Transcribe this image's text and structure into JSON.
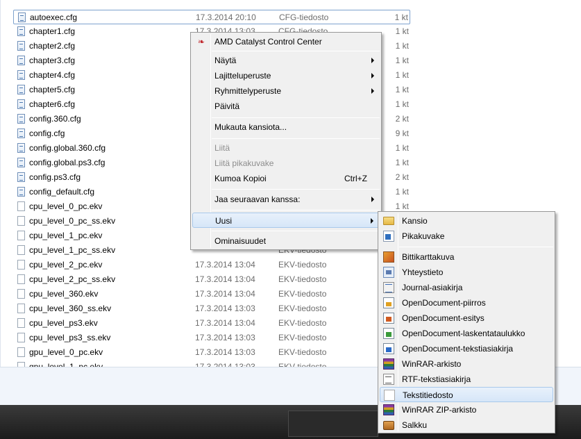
{
  "files": [
    {
      "name": "autoexec.cfg",
      "date": "17.3.2014 20:10",
      "type": "CFG-tiedosto",
      "size": "1 kt",
      "icon": "cfg-file-icon",
      "selected": true
    },
    {
      "name": "chapter1.cfg",
      "date": "17.3.2014 13:03",
      "type": "CFG-tiedosto",
      "size": "1 kt",
      "icon": "cfg-file-icon"
    },
    {
      "name": "chapter2.cfg",
      "date": "",
      "type": "",
      "size": "1 kt",
      "icon": "cfg-file-icon"
    },
    {
      "name": "chapter3.cfg",
      "date": "",
      "type": "",
      "size": "1 kt",
      "icon": "cfg-file-icon"
    },
    {
      "name": "chapter4.cfg",
      "date": "",
      "type": "",
      "size": "1 kt",
      "icon": "cfg-file-icon"
    },
    {
      "name": "chapter5.cfg",
      "date": "",
      "type": "",
      "size": "1 kt",
      "icon": "cfg-file-icon"
    },
    {
      "name": "chapter6.cfg",
      "date": "",
      "type": "",
      "size": "1 kt",
      "icon": "cfg-file-icon"
    },
    {
      "name": "config.360.cfg",
      "date": "",
      "type": "",
      "size": "2 kt",
      "icon": "cfg-file-icon"
    },
    {
      "name": "config.cfg",
      "date": "",
      "type": "",
      "size": "9 kt",
      "icon": "cfg-file-icon"
    },
    {
      "name": "config.global.360.cfg",
      "date": "",
      "type": "",
      "size": "1 kt",
      "icon": "cfg-file-icon"
    },
    {
      "name": "config.global.ps3.cfg",
      "date": "",
      "type": "",
      "size": "1 kt",
      "icon": "cfg-file-icon"
    },
    {
      "name": "config.ps3.cfg",
      "date": "",
      "type": "",
      "size": "2 kt",
      "icon": "cfg-file-icon"
    },
    {
      "name": "config_default.cfg",
      "date": "",
      "type": "",
      "size": "1 kt",
      "icon": "cfg-file-icon"
    },
    {
      "name": "cpu_level_0_pc.ekv",
      "date": "",
      "type": "",
      "size": "1 kt",
      "icon": "file-icon"
    },
    {
      "name": "cpu_level_0_pc_ss.ekv",
      "date": "",
      "type": "",
      "size": "",
      "icon": "file-icon"
    },
    {
      "name": "cpu_level_1_pc.ekv",
      "date": "",
      "type": "",
      "size": "",
      "icon": "file-icon"
    },
    {
      "name": "cpu_level_1_pc_ss.ekv",
      "date": "",
      "type": "EKV-tiedosto",
      "size": "",
      "icon": "file-icon"
    },
    {
      "name": "cpu_level_2_pc.ekv",
      "date": "17.3.2014 13:04",
      "type": "EKV-tiedosto",
      "size": "",
      "icon": "file-icon"
    },
    {
      "name": "cpu_level_2_pc_ss.ekv",
      "date": "17.3.2014 13:04",
      "type": "EKV-tiedosto",
      "size": "",
      "icon": "file-icon"
    },
    {
      "name": "cpu_level_360.ekv",
      "date": "17.3.2014 13:04",
      "type": "EKV-tiedosto",
      "size": "",
      "icon": "file-icon"
    },
    {
      "name": "cpu_level_360_ss.ekv",
      "date": "17.3.2014 13:03",
      "type": "EKV-tiedosto",
      "size": "",
      "icon": "file-icon"
    },
    {
      "name": "cpu_level_ps3.ekv",
      "date": "17.3.2014 13:04",
      "type": "EKV-tiedosto",
      "size": "",
      "icon": "file-icon"
    },
    {
      "name": "cpu_level_ps3_ss.ekv",
      "date": "17.3.2014 13:03",
      "type": "EKV-tiedosto",
      "size": "",
      "icon": "file-icon"
    },
    {
      "name": "gpu_level_0_pc.ekv",
      "date": "17.3.2014 13:03",
      "type": "EKV-tiedosto",
      "size": "",
      "icon": "file-icon"
    },
    {
      "name": "gpu_level_1_pc.ekv",
      "date": "17.3.2014 13:03",
      "type": "EKV-tiedosto",
      "size": "",
      "icon": "file-icon"
    }
  ],
  "context_menu": {
    "amd": "AMD Catalyst Control Center",
    "view": "Näytä",
    "sort": "Lajitteluperuste",
    "group": "Ryhmittelyperuste",
    "refresh": "Päivitä",
    "customize": "Mukauta kansiota...",
    "paste": "Liitä",
    "paste_shortcut": "Liitä pikakuvake",
    "undo": "Kumoa Kopioi",
    "undo_shortcut": "Ctrl+Z",
    "share": "Jaa seuraavan kanssa:",
    "new": "Uusi",
    "properties": "Ominaisuudet"
  },
  "new_submenu": [
    {
      "label": "Kansio",
      "icon": "folder-icon"
    },
    {
      "label": "Pikakuvake",
      "icon": "shortcut-icon"
    },
    {
      "label": "Bittikarttakuva",
      "icon": "bitmap-icon"
    },
    {
      "label": "Yhteystieto",
      "icon": "contact-icon"
    },
    {
      "label": "Journal-asiakirja",
      "icon": "journal-icon"
    },
    {
      "label": "OpenDocument-piirros",
      "icon": "odg-icon"
    },
    {
      "label": "OpenDocument-esitys",
      "icon": "odp-icon"
    },
    {
      "label": "OpenDocument-laskentataulukko",
      "icon": "ods-icon"
    },
    {
      "label": "OpenDocument-tekstiasiakirja",
      "icon": "odt-icon"
    },
    {
      "label": "WinRAR-arkisto",
      "icon": "winrar-icon"
    },
    {
      "label": "RTF-tekstiasiakirja",
      "icon": "rtf-icon"
    },
    {
      "label": "Tekstitiedosto",
      "icon": "text-file-icon"
    },
    {
      "label": "WinRAR ZIP-arkisto",
      "icon": "winrar-zip-icon"
    },
    {
      "label": "Salkku",
      "icon": "briefcase-icon"
    }
  ]
}
